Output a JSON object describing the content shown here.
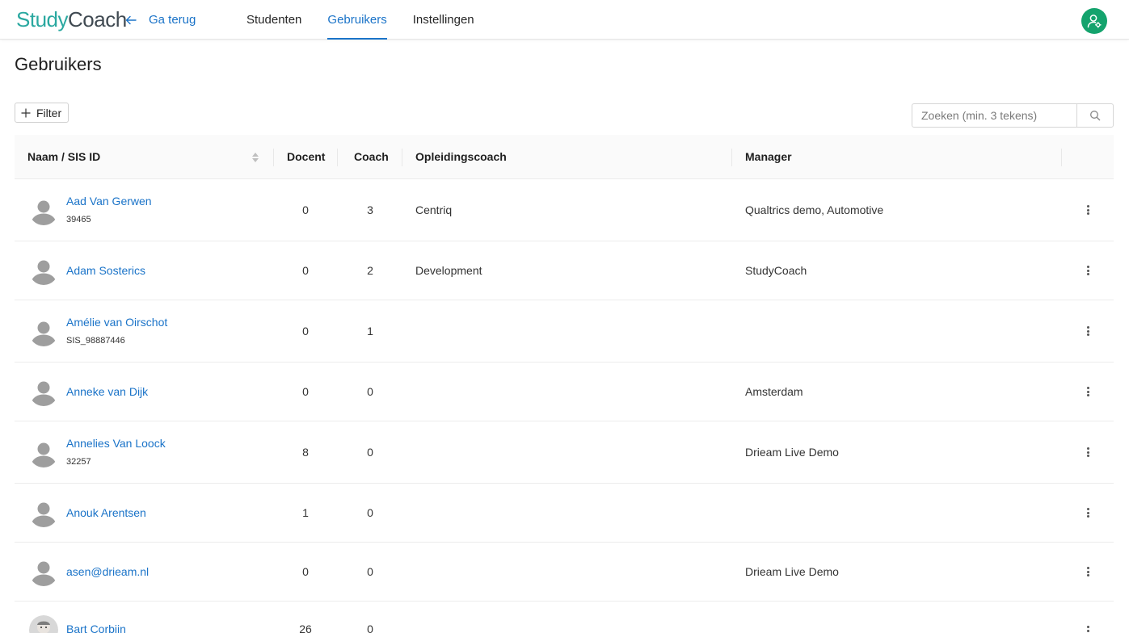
{
  "header": {
    "logo_study": "Study",
    "logo_coach": "Coach",
    "back_label": "Ga terug",
    "tabs": [
      {
        "label": "Studenten",
        "active": false
      },
      {
        "label": "Gebruikers",
        "active": true
      },
      {
        "label": "Instellingen",
        "active": false
      }
    ],
    "accent_color": "#1a73c8",
    "avatar_color": "#14a36d"
  },
  "page": {
    "title": "Gebruikers",
    "filter_label": "Filter",
    "search_placeholder": "Zoeken (min. 3 tekens)"
  },
  "table": {
    "columns": {
      "name": "Naam / SIS ID",
      "docent": "Docent",
      "coach": "Coach",
      "opleidingscoach": "Opleidingscoach",
      "manager": "Manager"
    },
    "rows": [
      {
        "name": "Aad Van Gerwen",
        "sis": "39465",
        "docent": "0",
        "coach": "3",
        "opleidingscoach": "Centriq",
        "manager": "Qualtrics demo, Automotive"
      },
      {
        "name": "Adam Sosterics",
        "sis": "",
        "docent": "0",
        "coach": "2",
        "opleidingscoach": "Development",
        "manager": "StudyCoach"
      },
      {
        "name": "Amélie van Oirschot",
        "sis": "SIS_98887446",
        "docent": "0",
        "coach": "1",
        "opleidingscoach": "",
        "manager": ""
      },
      {
        "name": "Anneke van Dijk",
        "sis": "",
        "docent": "0",
        "coach": "0",
        "opleidingscoach": "",
        "manager": "Amsterdam"
      },
      {
        "name": "Annelies Van Loock",
        "sis": "32257",
        "docent": "8",
        "coach": "0",
        "opleidingscoach": "",
        "manager": "Drieam Live Demo"
      },
      {
        "name": "Anouk Arentsen",
        "sis": "",
        "docent": "1",
        "coach": "0",
        "opleidingscoach": "",
        "manager": ""
      },
      {
        "name": "asen@drieam.nl",
        "sis": "",
        "docent": "0",
        "coach": "0",
        "opleidingscoach": "",
        "manager": "Drieam Live Demo"
      },
      {
        "name": "Bart Corbijn",
        "sis": "",
        "docent": "26",
        "coach": "0",
        "opleidingscoach": "",
        "manager": ""
      }
    ]
  }
}
